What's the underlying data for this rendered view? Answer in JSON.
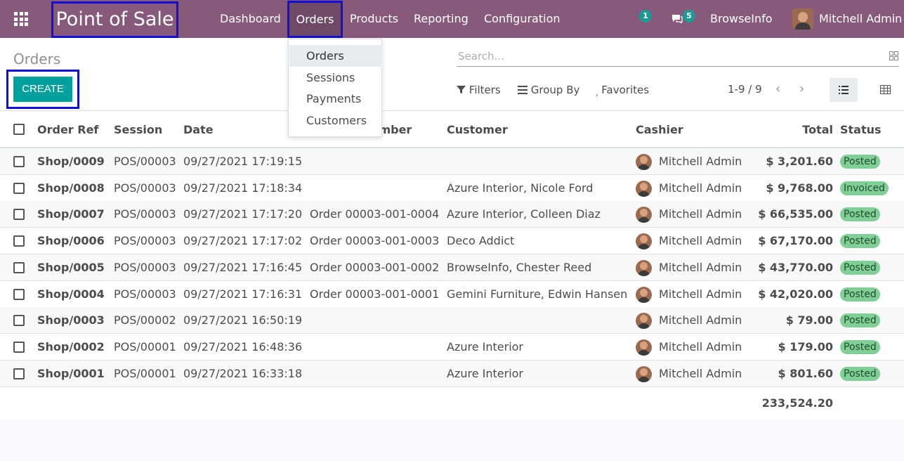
{
  "topbar": {
    "app_title": "Point of Sale",
    "nav": [
      "Dashboard",
      "Orders",
      "Products",
      "Reporting",
      "Configuration"
    ],
    "activity_count": "1",
    "message_count": "5",
    "company": "BrowseInfo",
    "user": "Mitchell Admin",
    "accent": "#875a7b"
  },
  "orders_menu": {
    "items": [
      "Orders",
      "Sessions",
      "Payments",
      "Customers"
    ],
    "active": "Orders"
  },
  "control_panel": {
    "breadcrumb": "Orders",
    "create_label": "CREATE",
    "search_placeholder": "Search...",
    "filters_label": "Filters",
    "groupby_label": "Group By",
    "favorites_label": "Favorites",
    "pager": "1-9 / 9"
  },
  "table": {
    "headers": {
      "order_ref": "Order Ref",
      "session": "Session",
      "date": "Date",
      "receipt": "Receipt Number",
      "customer": "Customer",
      "cashier": "Cashier",
      "total": "Total",
      "status": "Status"
    },
    "rows": [
      {
        "ref": "Shop/0009",
        "session": "POS/00003",
        "date": "09/27/2021 17:19:15",
        "receipt": "",
        "customer": "",
        "cashier": "Mitchell Admin",
        "total": "$ 3,201.60",
        "status": "Posted"
      },
      {
        "ref": "Shop/0008",
        "session": "POS/00003",
        "date": "09/27/2021 17:18:34",
        "receipt": "",
        "customer": "Azure Interior, Nicole Ford",
        "cashier": "Mitchell Admin",
        "total": "$ 9,768.00",
        "status": "Invoiced"
      },
      {
        "ref": "Shop/0007",
        "session": "POS/00003",
        "date": "09/27/2021 17:17:20",
        "receipt": "Order 00003-001-0004",
        "customer": "Azure Interior, Colleen Diaz",
        "cashier": "Mitchell Admin",
        "total": "$ 66,535.00",
        "status": "Posted"
      },
      {
        "ref": "Shop/0006",
        "session": "POS/00003",
        "date": "09/27/2021 17:17:02",
        "receipt": "Order 00003-001-0003",
        "customer": "Deco Addict",
        "cashier": "Mitchell Admin",
        "total": "$ 67,170.00",
        "status": "Posted"
      },
      {
        "ref": "Shop/0005",
        "session": "POS/00003",
        "date": "09/27/2021 17:16:45",
        "receipt": "Order 00003-001-0002",
        "customer": "BrowseInfo, Chester Reed",
        "cashier": "Mitchell Admin",
        "total": "$ 43,770.00",
        "status": "Posted"
      },
      {
        "ref": "Shop/0004",
        "session": "POS/00003",
        "date": "09/27/2021 17:16:31",
        "receipt": "Order 00003-001-0001",
        "customer": "Gemini Furniture, Edwin Hansen",
        "cashier": "Mitchell Admin",
        "total": "$ 42,020.00",
        "status": "Posted"
      },
      {
        "ref": "Shop/0003",
        "session": "POS/00002",
        "date": "09/27/2021 16:50:19",
        "receipt": "",
        "customer": "",
        "cashier": "Mitchell Admin",
        "total": "$ 79.00",
        "status": "Posted"
      },
      {
        "ref": "Shop/0002",
        "session": "POS/00001",
        "date": "09/27/2021 16:48:36",
        "receipt": "",
        "customer": "Azure Interior",
        "cashier": "Mitchell Admin",
        "total": "$ 179.00",
        "status": "Posted"
      },
      {
        "ref": "Shop/0001",
        "session": "POS/00001",
        "date": "09/27/2021 16:33:18",
        "receipt": "",
        "customer": "Azure Interior",
        "cashier": "Mitchell Admin",
        "total": "$ 801.60",
        "status": "Posted"
      }
    ],
    "grand_total": "233,524.20"
  }
}
